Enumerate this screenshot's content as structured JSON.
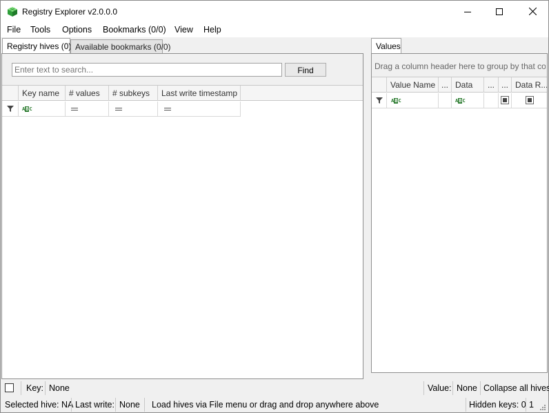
{
  "window": {
    "title": "Registry Explorer v2.0.0.0"
  },
  "menu": [
    "File",
    "Tools",
    "Options",
    "Bookmarks (0/0)",
    "View",
    "Help"
  ],
  "left_tabs": [
    "Registry hives (0)",
    "Available bookmarks (0/0)"
  ],
  "search": {
    "placeholder": "Enter text to search...",
    "find_label": "Find"
  },
  "hive_grid": {
    "columns": [
      "Key name",
      "# values",
      "# subkeys",
      "Last write timestamp"
    ]
  },
  "values_panel": {
    "tab": "Values",
    "group_hint": "Drag a column header here to group by that column",
    "columns": [
      "Value Name",
      "...",
      "Data",
      "...",
      "...",
      "Data R..."
    ]
  },
  "statusbar": {
    "key_label": "Key:",
    "key_value": "None",
    "value_label": "Value:",
    "value_value": "None",
    "collapse_label": "Collapse all hives",
    "selected_hive": "Selected hive: NA",
    "last_write_label": "Last write:",
    "last_write_value": "None",
    "message": "Load hives via File menu or drag and drop anywhere above",
    "hidden_keys": "Hidden keys: 0",
    "count": "1"
  },
  "icons": {
    "app": "registry-cube-icon",
    "filter": "filter-icon",
    "abc": "text-filter-icon",
    "eq": "equals-filter-icon"
  }
}
